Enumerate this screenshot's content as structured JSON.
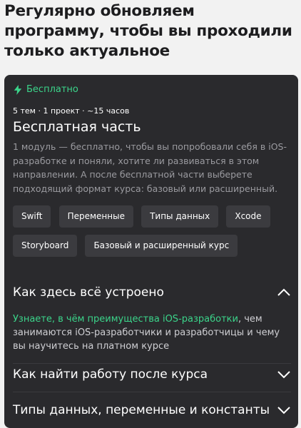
{
  "headline": "Регулярно обновляем программу, чтобы вы проходили только актуальное",
  "card": {
    "badge": "Бесплатно",
    "meta": "5 тем · 1 проект · ~15 часов",
    "title": "Бесплатная часть",
    "description": "1 модуль — бесплатно, чтобы вы попробовали себя в iOS-разработке и поняли, хотите ли развиваться в этом направлении. А после бесплатной части выберете подходящий формат курса: базовый или расширенный.",
    "tags": [
      "Swift",
      "Переменные",
      "Типы данных",
      "Xcode",
      "Storyboard",
      "Базовый и расширенный курс"
    ],
    "accordion": [
      {
        "title": "Как здесь всё устроено",
        "expanded": true,
        "link_text": "Узнаете, в чём преимущества iOS-разработки",
        "body_text": ", чем занимаются iOS-разработчики и разработчицы и чему вы научитесь на платном курсе"
      },
      {
        "title": "Как найти работу после курса",
        "expanded": false
      },
      {
        "title": "Типы данных, переменные и константы",
        "expanded": false
      }
    ]
  },
  "colors": {
    "accent": "#3bd48a",
    "card_bg": "#2a2a2d",
    "tag_bg": "#3b3b3f"
  }
}
